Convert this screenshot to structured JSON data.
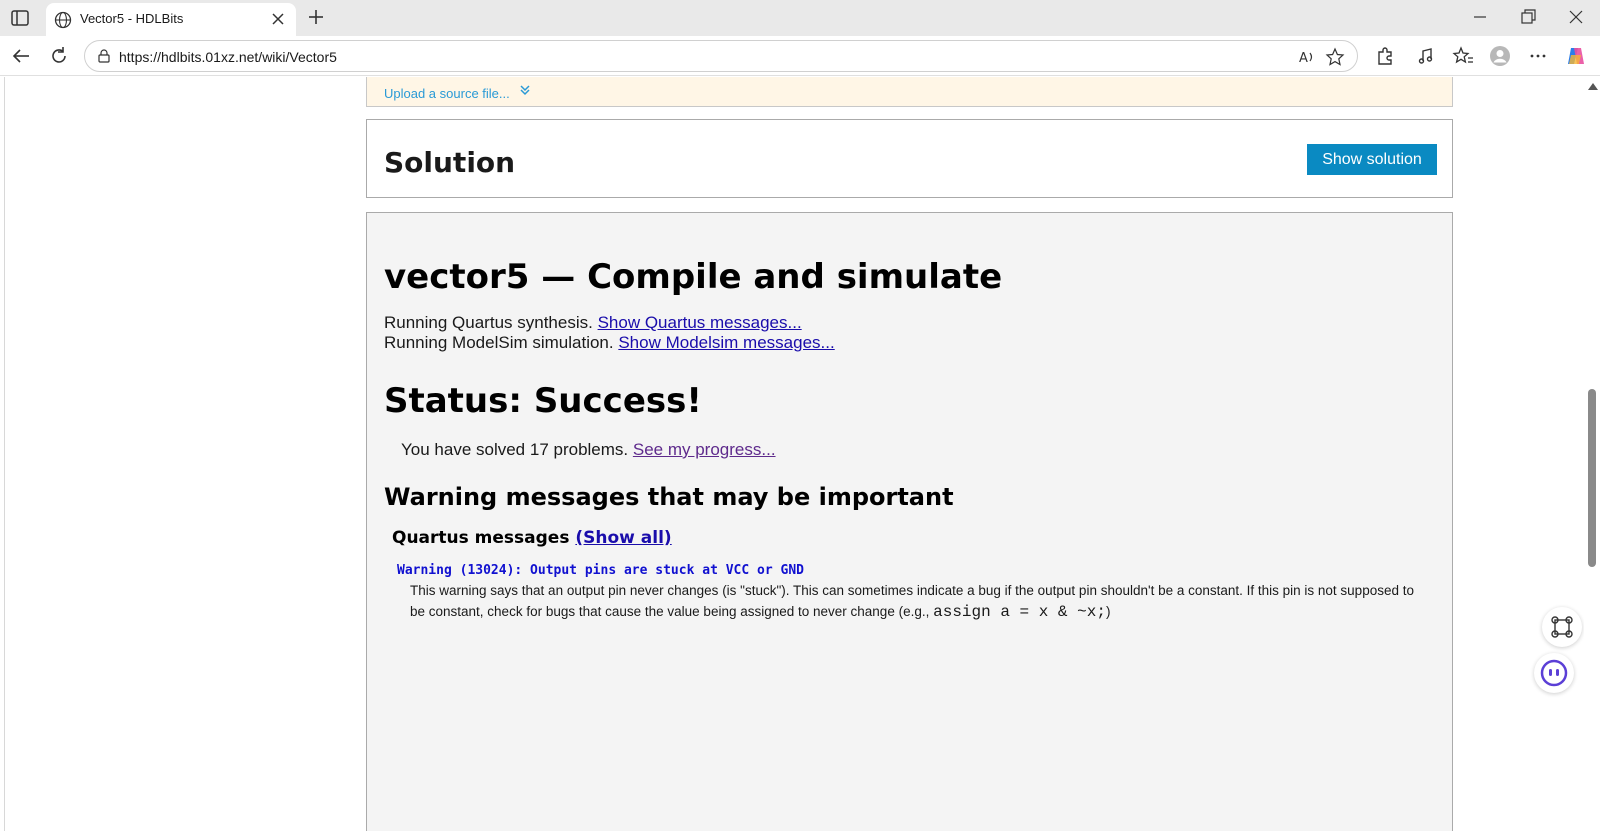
{
  "browser": {
    "tab_title": "Vector5 - HDLBits",
    "url": "https://hdlbits.01xz.net/wiki/Vector5"
  },
  "upload": {
    "link_text": "Upload a source file..."
  },
  "solution": {
    "heading": "Solution",
    "button_label": "Show solution"
  },
  "result": {
    "title": "vector5 — Compile and simulate",
    "quartus_line_prefix": "Running Quartus synthesis.",
    "quartus_link": "Show Quartus messages...",
    "modelsim_line_prefix": "Running ModelSim simulation.",
    "modelsim_link": "Show Modelsim messages...",
    "status": "Status: Success!",
    "solved_prefix": "You have solved 17 problems.",
    "progress_link": "See my progress...",
    "warnings_heading": "Warning messages that may be important",
    "quartus_messages_label": "Quartus messages",
    "show_all_link": "(Show all)",
    "warning_code": "Warning (13024): Output pins are stuck at VCC or GND",
    "warning_desc_text": "This warning says that an output pin never changes (is \"stuck\"). This can sometimes indicate a bug if the output pin shouldn't be a constant. If this pin is not supposed to be constant, check for bugs that cause the value being assigned to never change (e.g.,",
    "warning_desc_code": "assign a = x & ~x;",
    "warning_desc_end": ")"
  },
  "colors": {
    "button_blue": "#0a8ac2",
    "upload_bg": "#fff6e6",
    "result_bg": "#f4f4f4",
    "warning_blue": "#1010d0"
  }
}
